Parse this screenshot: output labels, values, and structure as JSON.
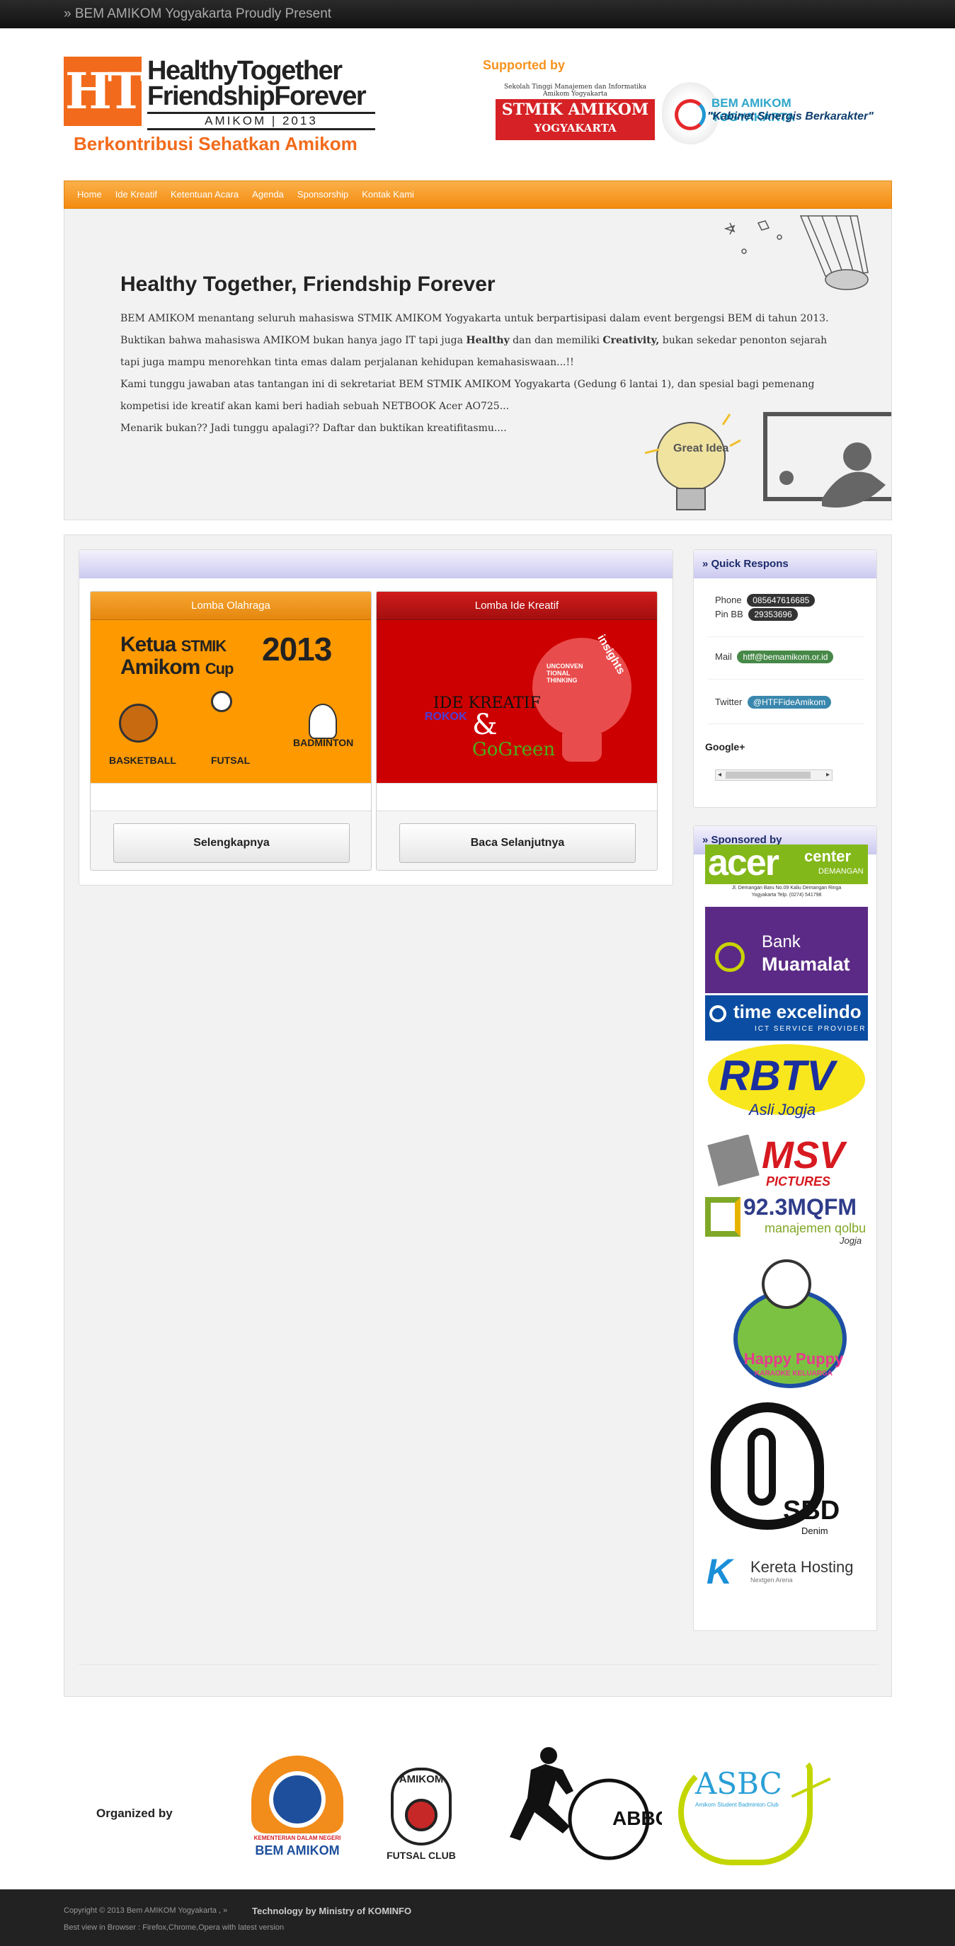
{
  "topbar": {
    "text": "» BEM AMIKOM Yogyakarta Proudly Present"
  },
  "header": {
    "logo": {
      "mark": "HT",
      "line1": "HealthyTogether",
      "line2": "FriendshipForever",
      "line3": "AMIKOM | 2013",
      "tagline": "Berkontribusi Sehatkan Amikom"
    },
    "supported_label": "Supported by",
    "stmik": {
      "top": "Sekolah Tinggi Manajemen dan Informatika Amikom Yogyakarta",
      "name": "STMIK AMIKOM",
      "city": "YOGYAKARTA"
    },
    "bem": {
      "name": "BEM AMIKOM YOGYAKARTA",
      "slogan": "\"Kabinet Sinergis Berkarakter\""
    }
  },
  "nav": {
    "items": [
      "Home",
      "Ide Kreatif",
      "Ketentuan Acara",
      "Agenda",
      "Sponsorship",
      "Kontak Kami"
    ]
  },
  "hero": {
    "title": "Healthy Together, Friendship Forever",
    "line1": "BEM AMIKOM menantang seluruh mahasiswa STMIK AMIKOM Yogyakarta untuk berpartisipasi dalam event bergengsi BEM di tahun 2013.",
    "line2a": "Buktikan bahwa mahasiswa AMIKOM bukan hanya jago IT tapi juga ",
    "line2b": "Healthy",
    "line2c": " dan dan memiliki ",
    "line2d": "Creativity,",
    "line2e": " bukan sekedar penonton sejarah",
    "line3": "tapi juga mampu menorehkan tinta emas dalam perjalanan kehidupan kemahasiswaan...!!",
    "line4": "Kami tunggu jawaban atas tantangan ini di sekretariat BEM STMIK AMIKOM Yogyakarta (Gedung 6 lantai 1), dan spesial bagi pemenang",
    "line5": "kompetisi ide kreatif akan kami beri hadiah sebuah NETBOOK Acer AO725...",
    "line6": "Menarik bukan?? Jadi tunggu apalagi?? Daftar dan buktikan kreatifitasmu....",
    "bulb_text": "Great Idea"
  },
  "cards": [
    {
      "title": "Lomba Olahraga",
      "button": "Selengkapnya",
      "art": {
        "l1": "Ketua",
        "l2": "Amikom",
        "l3": "STMIK",
        "l4": "Cup",
        "year": "2013",
        "sports": [
          "BASKETBALL",
          "FUTSAL",
          "BADMINTON"
        ]
      }
    },
    {
      "title": "Lomba Ide Kreatif",
      "button": "Baca Selanjutnya",
      "art": {
        "t1": "IDE KREATIF",
        "t2": "ROKOK",
        "amp": "&",
        "t3": "GoGreen",
        "b1": "insights",
        "b2": "UNCONVEN TIONAL THINKING"
      }
    }
  ],
  "quick": {
    "title": "» Quick Respons",
    "phone_label": "Phone",
    "phone": "085647616685",
    "pinbb_label": "Pin BB",
    "pinbb": "29353696",
    "mail_label": "Mail",
    "mail": "htff@bemamikom.or.id",
    "twitter_label": "Twitter",
    "twitter": "@HTFFideAmikom",
    "gplus": "Google+"
  },
  "sponsored": {
    "title": "» Sponsored by",
    "acer": {
      "name": "acer",
      "center": "center",
      "loc": "DEMANGAN",
      "addr1": "Jl. Demangan Baru No.09 Kaliu Demangan Ringa",
      "addr2": "Yogyakarta Telp. (0274) 541798"
    },
    "muamalat": {
      "l1": "Bank",
      "l2": "Muamalat"
    },
    "time": {
      "name": "time excelindo",
      "sub": "ICT SERVICE PROVIDER"
    },
    "rbtv": {
      "name": "RBTV",
      "sub": "Asli Jogja"
    },
    "msv": {
      "name": "MSV",
      "sub": "PICTURES"
    },
    "mqfm": {
      "name": "92.3MQFM",
      "sub": "manajemen qolbu",
      "city": "Jogja"
    },
    "happy": {
      "name": "Happy Puppy",
      "sub": "KARAOKE KELUARGA"
    },
    "sbd": {
      "name": "SBD",
      "sub": "Denim"
    },
    "kereta": {
      "name": "Kereta Hosting",
      "sub": "Nextgen Arena"
    }
  },
  "organized": {
    "label": "Organized by",
    "bem_top": "KEMENTERIAN DALAM NEGERI",
    "bem": "BEM AMIKOM",
    "futsal_top": "AMIKOM",
    "futsal": "FUTSAL CLUB",
    "abbc": "ABBC",
    "asbc": "ASBC",
    "asbc_sub": "Amikom Student Badminton Club"
  },
  "footer": {
    "copyright": "Copyright © 2013 Bem AMIKOM Yogyakarta , »",
    "tech": "Technology by Ministry of KOMINFO",
    "best": "Best view in Browser : Firefox,Chrome,Opera with latest version"
  }
}
